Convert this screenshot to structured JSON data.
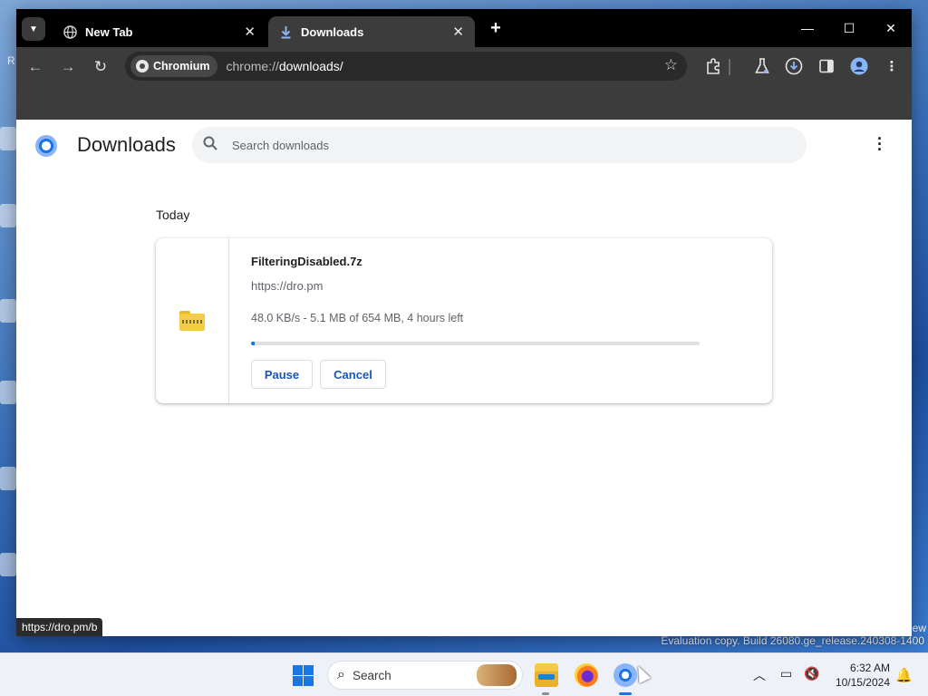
{
  "tabs": [
    {
      "label": "New Tab",
      "icon": "globe-icon"
    },
    {
      "label": "Downloads",
      "icon": "download-icon",
      "active": true
    }
  ],
  "window_controls": {
    "minimize": "—",
    "maximize": "☐",
    "close": "✕"
  },
  "omnibox": {
    "chip_label": "Chromium",
    "url_scheme": "chrome://",
    "url_host": "downloads/"
  },
  "page": {
    "title": "Downloads",
    "search_placeholder": "Search downloads",
    "section_date": "Today",
    "download": {
      "file_name": "FilteringDisabled.7z",
      "source_url": "https://dro.pm",
      "status": "48.0 KB/s - 5.1 MB of 654 MB, 4 hours left",
      "progress_fraction": 0.008,
      "pause_label": "Pause",
      "cancel_label": "Cancel"
    }
  },
  "status_bubble": "https://dro.pm/b",
  "watermark": "Evaluation copy. Build 26080.ge_release.240308-1400",
  "watermark_edge": "ew",
  "taskbar": {
    "search_label": "Search",
    "time": "6:32 AM",
    "date": "10/15/2024"
  },
  "colors": {
    "accent": "#1a73e8",
    "tabstrip": "#000000",
    "toolbar": "#3c3c3c"
  }
}
